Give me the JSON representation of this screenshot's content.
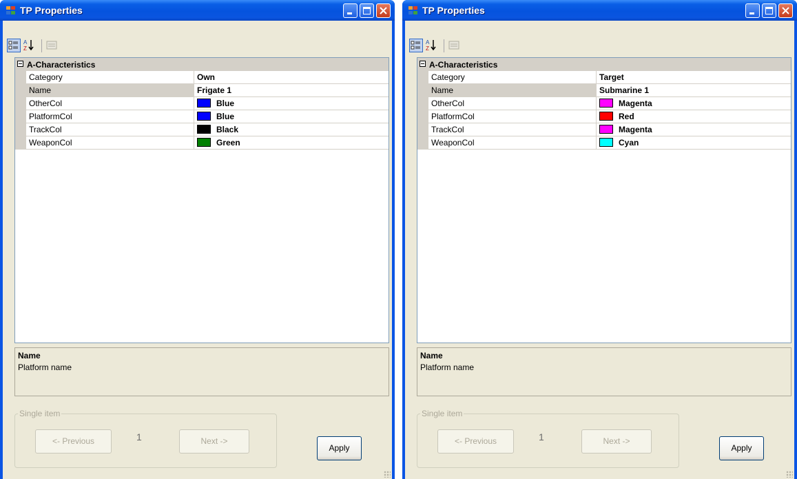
{
  "windows": [
    {
      "title": "TP  Properties",
      "category_label": "A-Characteristics",
      "properties": [
        {
          "name": "Category",
          "value": "Own",
          "color": null,
          "selected": false
        },
        {
          "name": "Name",
          "value": "Frigate 1",
          "color": null,
          "selected": true
        },
        {
          "name": "OtherCol",
          "value": "Blue",
          "color": "#0000ff",
          "selected": false
        },
        {
          "name": "PlatformCol",
          "value": "Blue",
          "color": "#0000ff",
          "selected": false
        },
        {
          "name": "TrackCol",
          "value": "Black",
          "color": "#000000",
          "selected": false
        },
        {
          "name": "WeaponCol",
          "value": "Green",
          "color": "#008000",
          "selected": false
        }
      ],
      "help_title": "Name",
      "help_desc": "Platform name",
      "group_label": "Single item",
      "prev_label": "<- Previous",
      "next_label": "Next ->",
      "counter": "1",
      "apply_label": "Apply"
    },
    {
      "title": "TP  Properties",
      "category_label": "A-Characteristics",
      "properties": [
        {
          "name": "Category",
          "value": "Target",
          "color": null,
          "selected": false
        },
        {
          "name": "Name",
          "value": "Submarine 1",
          "color": null,
          "selected": true
        },
        {
          "name": "OtherCol",
          "value": "Magenta",
          "color": "#ff00ff",
          "selected": false
        },
        {
          "name": "PlatformCol",
          "value": "Red",
          "color": "#ff0000",
          "selected": false
        },
        {
          "name": "TrackCol",
          "value": "Magenta",
          "color": "#ff00ff",
          "selected": false
        },
        {
          "name": "WeaponCol",
          "value": "Cyan",
          "color": "#00ffff",
          "selected": false
        }
      ],
      "help_title": "Name",
      "help_desc": "Platform name",
      "group_label": "Single item",
      "prev_label": "<- Previous",
      "next_label": "Next ->",
      "counter": "1",
      "apply_label": "Apply"
    }
  ],
  "icons": {
    "window": "app-properties-icon",
    "categorized": "categorized-view-icon",
    "alphabetical": "sort-alphabetical-icon",
    "property_pages": "property-pages-icon",
    "minimize": "minimize-icon",
    "maximize": "maximize-icon",
    "close": "close-icon"
  }
}
